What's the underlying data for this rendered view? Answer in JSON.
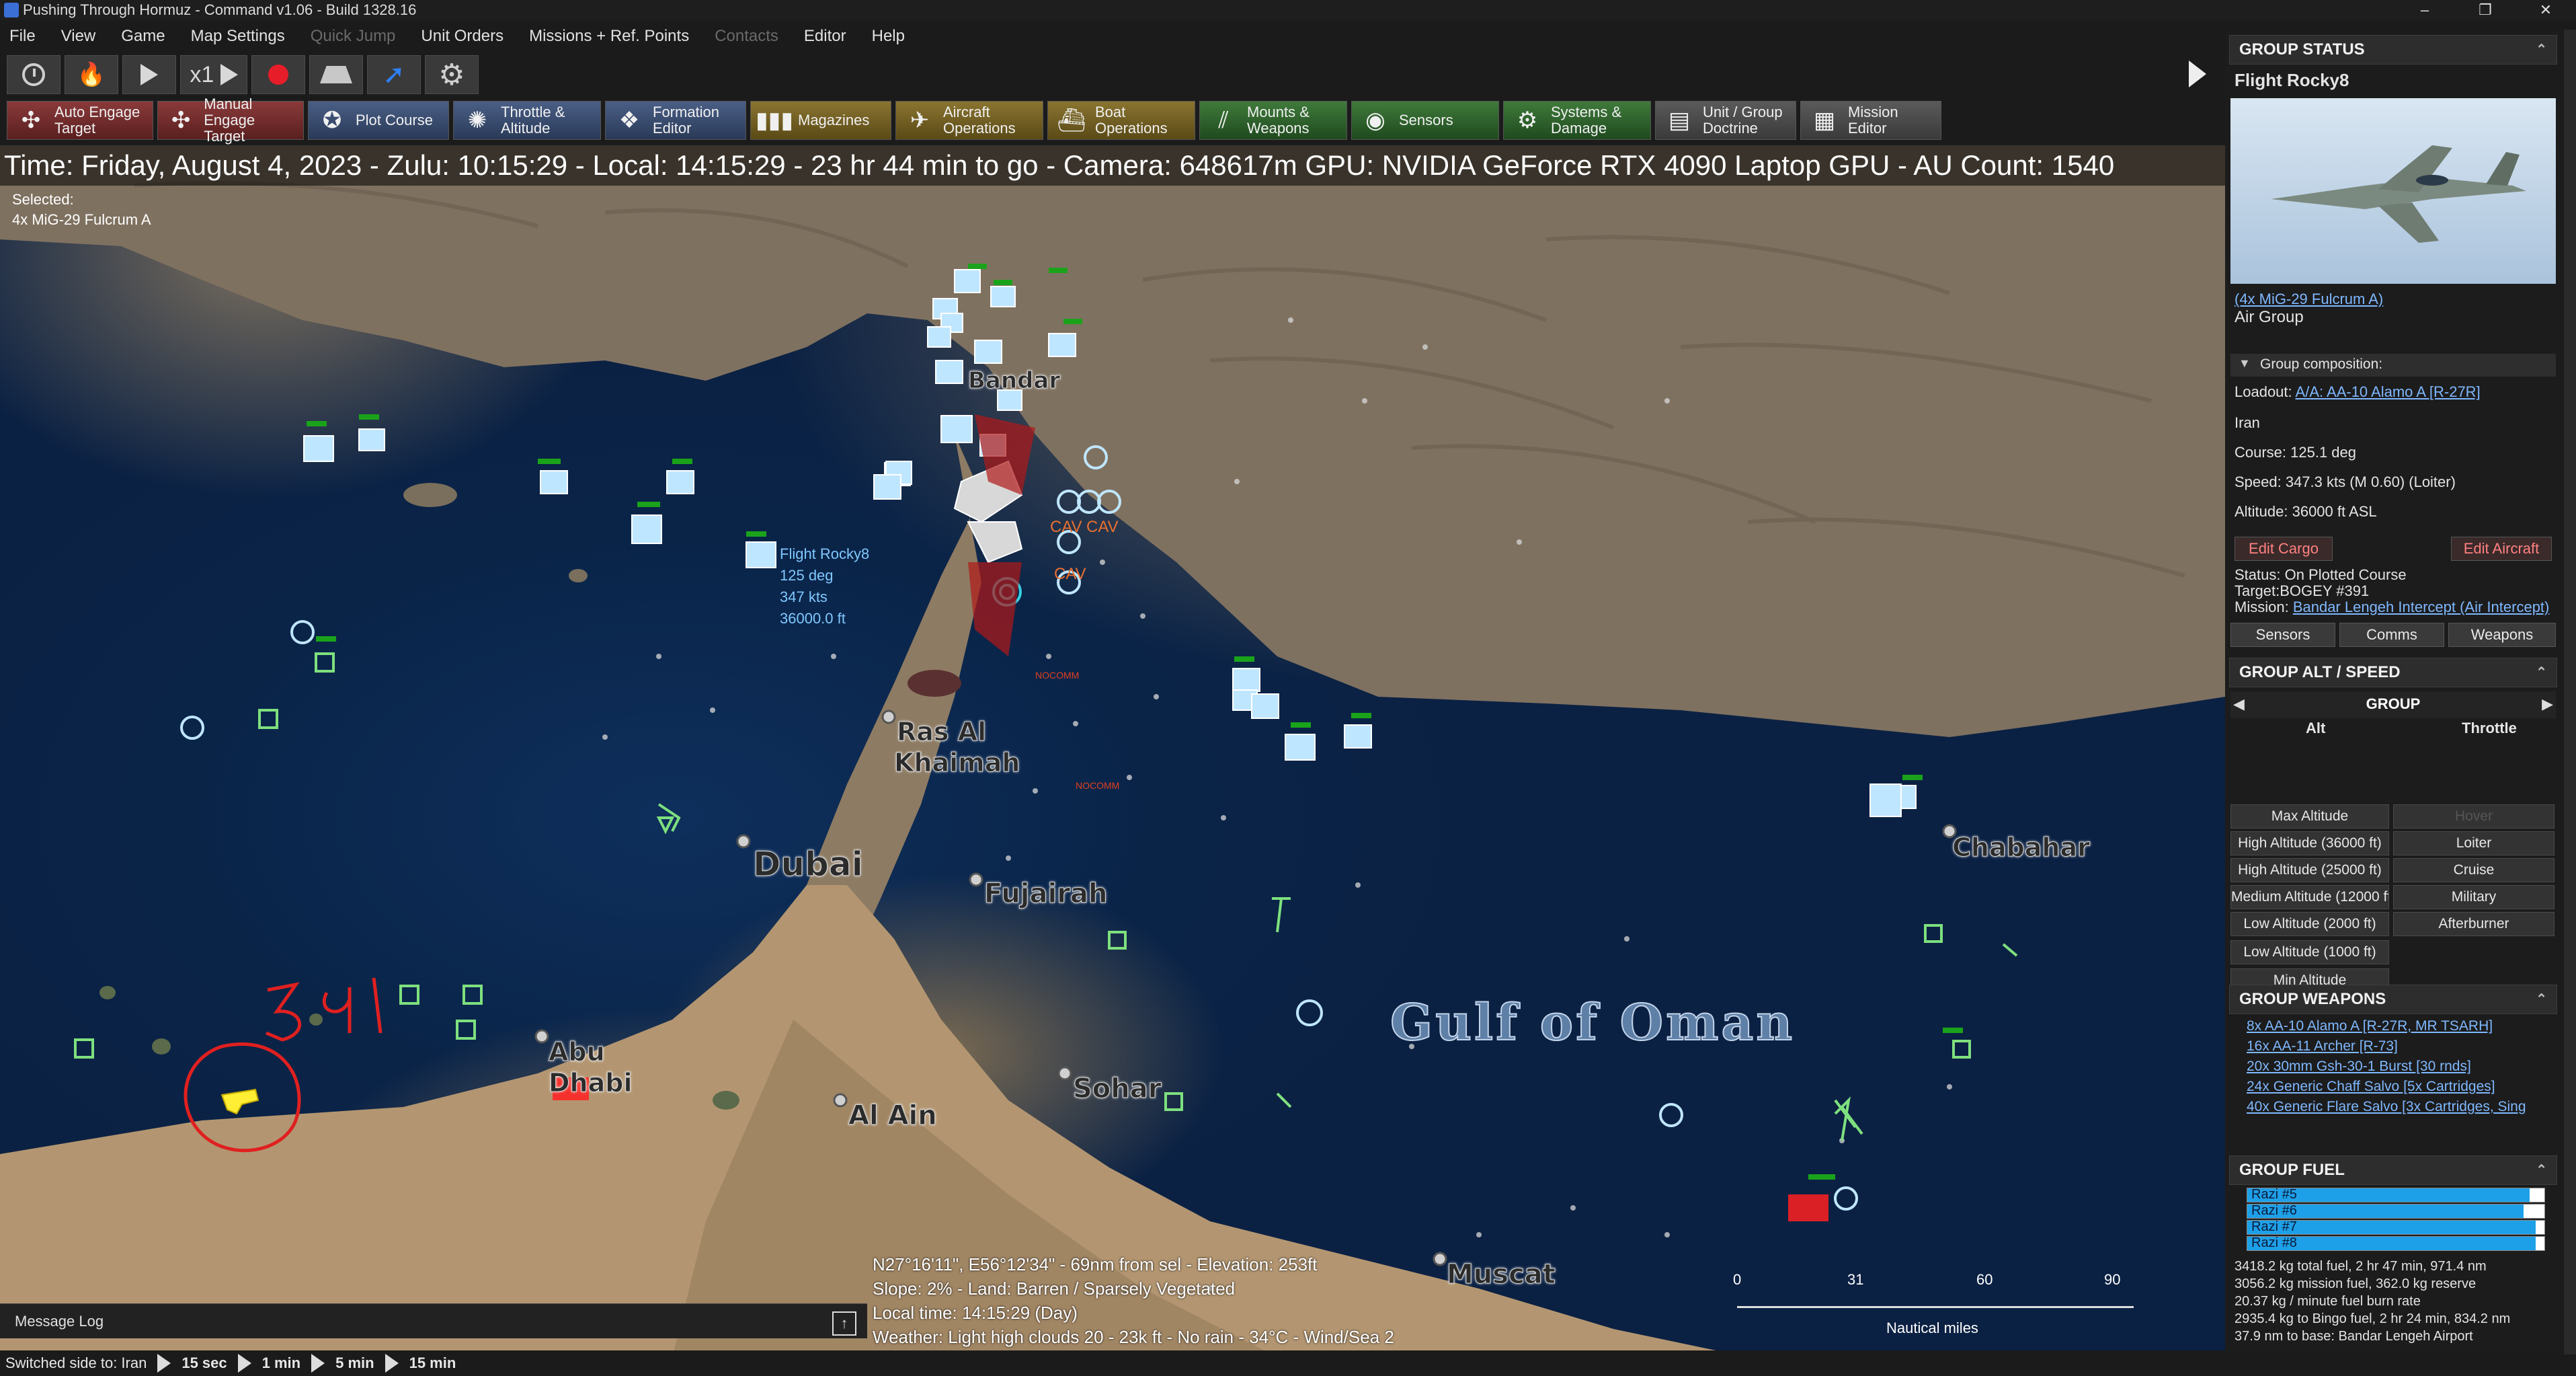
{
  "window": {
    "title": "Pushing Through Hormuz - Command v1.06 - Build 1328.16",
    "controls": [
      "–",
      "❐",
      "✕"
    ]
  },
  "menu": [
    {
      "label": "File",
      "enabled": true
    },
    {
      "label": "View",
      "enabled": true
    },
    {
      "label": "Game",
      "enabled": true
    },
    {
      "label": "Map Settings",
      "enabled": true
    },
    {
      "label": "Quick Jump",
      "enabled": false
    },
    {
      "label": "Unit Orders",
      "enabled": true
    },
    {
      "label": "Missions + Ref. Points",
      "enabled": true
    },
    {
      "label": "Contacts",
      "enabled": false
    },
    {
      "label": "Editor",
      "enabled": true
    },
    {
      "label": "Help",
      "enabled": true
    }
  ],
  "toolbar1": {
    "speed_multiplier": "x1"
  },
  "toolbar2": [
    {
      "line1": "Auto Engage",
      "line2": "Target",
      "icon": "crosshair-icon",
      "glyph": "✣",
      "style": "red"
    },
    {
      "line1": "Manual",
      "line2": "Engage Target",
      "icon": "crosshair-icon",
      "glyph": "✣",
      "style": "red"
    },
    {
      "line1": "Plot Course",
      "line2": "",
      "icon": "compass-icon",
      "glyph": "✪",
      "style": "blue"
    },
    {
      "line1": "Throttle &",
      "line2": "Altitude",
      "icon": "throttle-icon",
      "glyph": "✺",
      "style": "blue"
    },
    {
      "line1": "Formation",
      "line2": "Editor",
      "icon": "formation-icon",
      "glyph": "❖",
      "style": "blue"
    },
    {
      "line1": "Magazines",
      "line2": "",
      "icon": "magazine-icon",
      "glyph": "▮▮▮",
      "style": "gold"
    },
    {
      "line1": "Aircraft",
      "line2": "Operations",
      "icon": "aircraft-icon",
      "glyph": "✈",
      "style": "gold"
    },
    {
      "line1": "Boat",
      "line2": "Operations",
      "icon": "boat-icon",
      "glyph": "⛴",
      "style": "gold"
    },
    {
      "line1": "Mounts &",
      "line2": "Weapons",
      "icon": "weapons-icon",
      "glyph": "⫽",
      "style": "green"
    },
    {
      "line1": "Sensors",
      "line2": "",
      "icon": "sensor-icon",
      "glyph": "◉",
      "style": "green"
    },
    {
      "line1": "Systems &",
      "line2": "Damage",
      "icon": "systems-icon",
      "glyph": "⚙",
      "style": "green"
    },
    {
      "line1": "Unit / Group",
      "line2": "Doctrine",
      "icon": "doctrine-icon",
      "glyph": "▤",
      "style": "gray"
    },
    {
      "line1": "Mission",
      "line2": "Editor",
      "icon": "mission-icon",
      "glyph": "▦",
      "style": "gray"
    }
  ],
  "banner": {
    "text": "Time: Friday, August 4, 2023 - Zulu: 10:15:29 - Local: 14:15:29 - 23 hr 44 min to go -  Camera: 648617m  GPU: NVIDIA GeForce RTX 4090 Laptop GPU - AU Count: 1540"
  },
  "selected": {
    "label": "Selected:",
    "unit": "4x MiG-29 Fulcrum A"
  },
  "map_labels": {
    "cities": [
      "Bandar",
      "Ras Al",
      "Khaimah",
      "Dubai",
      "Fujairah",
      "Chabahar",
      "Abu",
      "Dhabi",
      "Sohar",
      "Al Ain",
      "Muscat"
    ],
    "gulf": "Gulf of Oman",
    "annotation": "391",
    "nocomm": "NOCOMM",
    "cav": "CAV"
  },
  "unit_label": {
    "name": "Flight Rocky8",
    "course": "125 deg",
    "speed": "347 kts",
    "altitude": "36000.0 ft"
  },
  "map_info": {
    "line1": "N27°16'11\", E56°12'34\" - 69nm from sel - Elevation: 253ft",
    "line2": "Slope: 2%  - Land: Barren / Sparsely Vegetated",
    "line3": "Local time: 14:15:29 (Day)",
    "line4": "Weather: Light high clouds 20 - 23k ft - No rain - 34°C - Wind/Sea 2"
  },
  "scale": {
    "ticks": [
      "0",
      "31",
      "60",
      "90"
    ],
    "unit": "Nautical miles"
  },
  "message_log": {
    "label": "Message Log"
  },
  "statusbar": {
    "side": "Switched side to: Iran",
    "steps": [
      "15 sec",
      "1 min",
      "5 min",
      "15 min"
    ]
  },
  "group_status": {
    "header": "GROUP STATUS",
    "name": "Flight Rocky8",
    "link": "(4x MiG-29 Fulcrum A)",
    "type": "Air Group",
    "composition": "Group composition:",
    "loadout_label": "Loadout:",
    "loadout_link": "A/A: AA-10 Alamo A [R-27R]",
    "side": "Iran",
    "course": "Course: 125.1 deg",
    "speed": "Speed: 347.3 kts (M 0.60) (Loiter)",
    "altitude": "Altitude: 36000 ft ASL",
    "edit_cargo": "Edit Cargo",
    "edit_aircraft": "Edit Aircraft",
    "status": "Status: On Plotted Course",
    "target": "Target:BOGEY #391",
    "mission_label": "Mission:",
    "mission_link": "Bandar Lengeh Intercept (Air Intercept)",
    "tabs": [
      "Sensors",
      "Comms",
      "Weapons"
    ]
  },
  "group_alt": {
    "header": "GROUP ALT / SPEED",
    "group": "GROUP",
    "alt": "Alt",
    "throttle": "Throttle",
    "alt_buttons": [
      "Max Altitude",
      "High Altitude (36000 ft)",
      "High Altitude (25000 ft)",
      "Medium Altitude (12000 ft)",
      "Low Altitude (2000 ft)",
      "Low Altitude (1000 ft)",
      "Min Altitude"
    ],
    "throttle_buttons": [
      "Hover",
      "Loiter",
      "Cruise",
      "Military",
      "Afterburner"
    ]
  },
  "group_weapons": {
    "header": "GROUP WEAPONS",
    "items": [
      "8x AA-10 Alamo A [R-27R, MR TSARH]",
      "16x AA-11 Archer [R-73]",
      "20x 30mm Gsh-30-1 Burst [30 rnds]",
      "24x Generic Chaff Salvo [5x Cartridges]",
      "40x Generic Flare Salvo [3x Cartridges, Sing"
    ]
  },
  "group_fuel": {
    "header": "GROUP FUEL",
    "bars": [
      {
        "name": "Razi #5",
        "level": 0.95
      },
      {
        "name": "Razi #6",
        "level": 0.93
      },
      {
        "name": "Razi #7",
        "level": 0.97
      },
      {
        "name": "Razi #8",
        "level": 0.97
      }
    ],
    "lines": [
      "3418.2 kg total fuel, 2 hr 47 min, 971.4 nm",
      "3056.2 kg mission fuel, 362.0 kg reserve",
      "20.37 kg / minute fuel burn rate",
      "2935.4 kg to Bingo fuel, 2 hr 24 min, 834.2 nm",
      "37.9 nm to base: Bandar Lengeh Airport"
    ]
  },
  "colors": {
    "water": "#0b2a52",
    "land": "#84765f",
    "friendly": "#8fd0ff",
    "hostile": "#e02020",
    "unknown": "#7ee07e",
    "accent": "#1ea0e8"
  }
}
